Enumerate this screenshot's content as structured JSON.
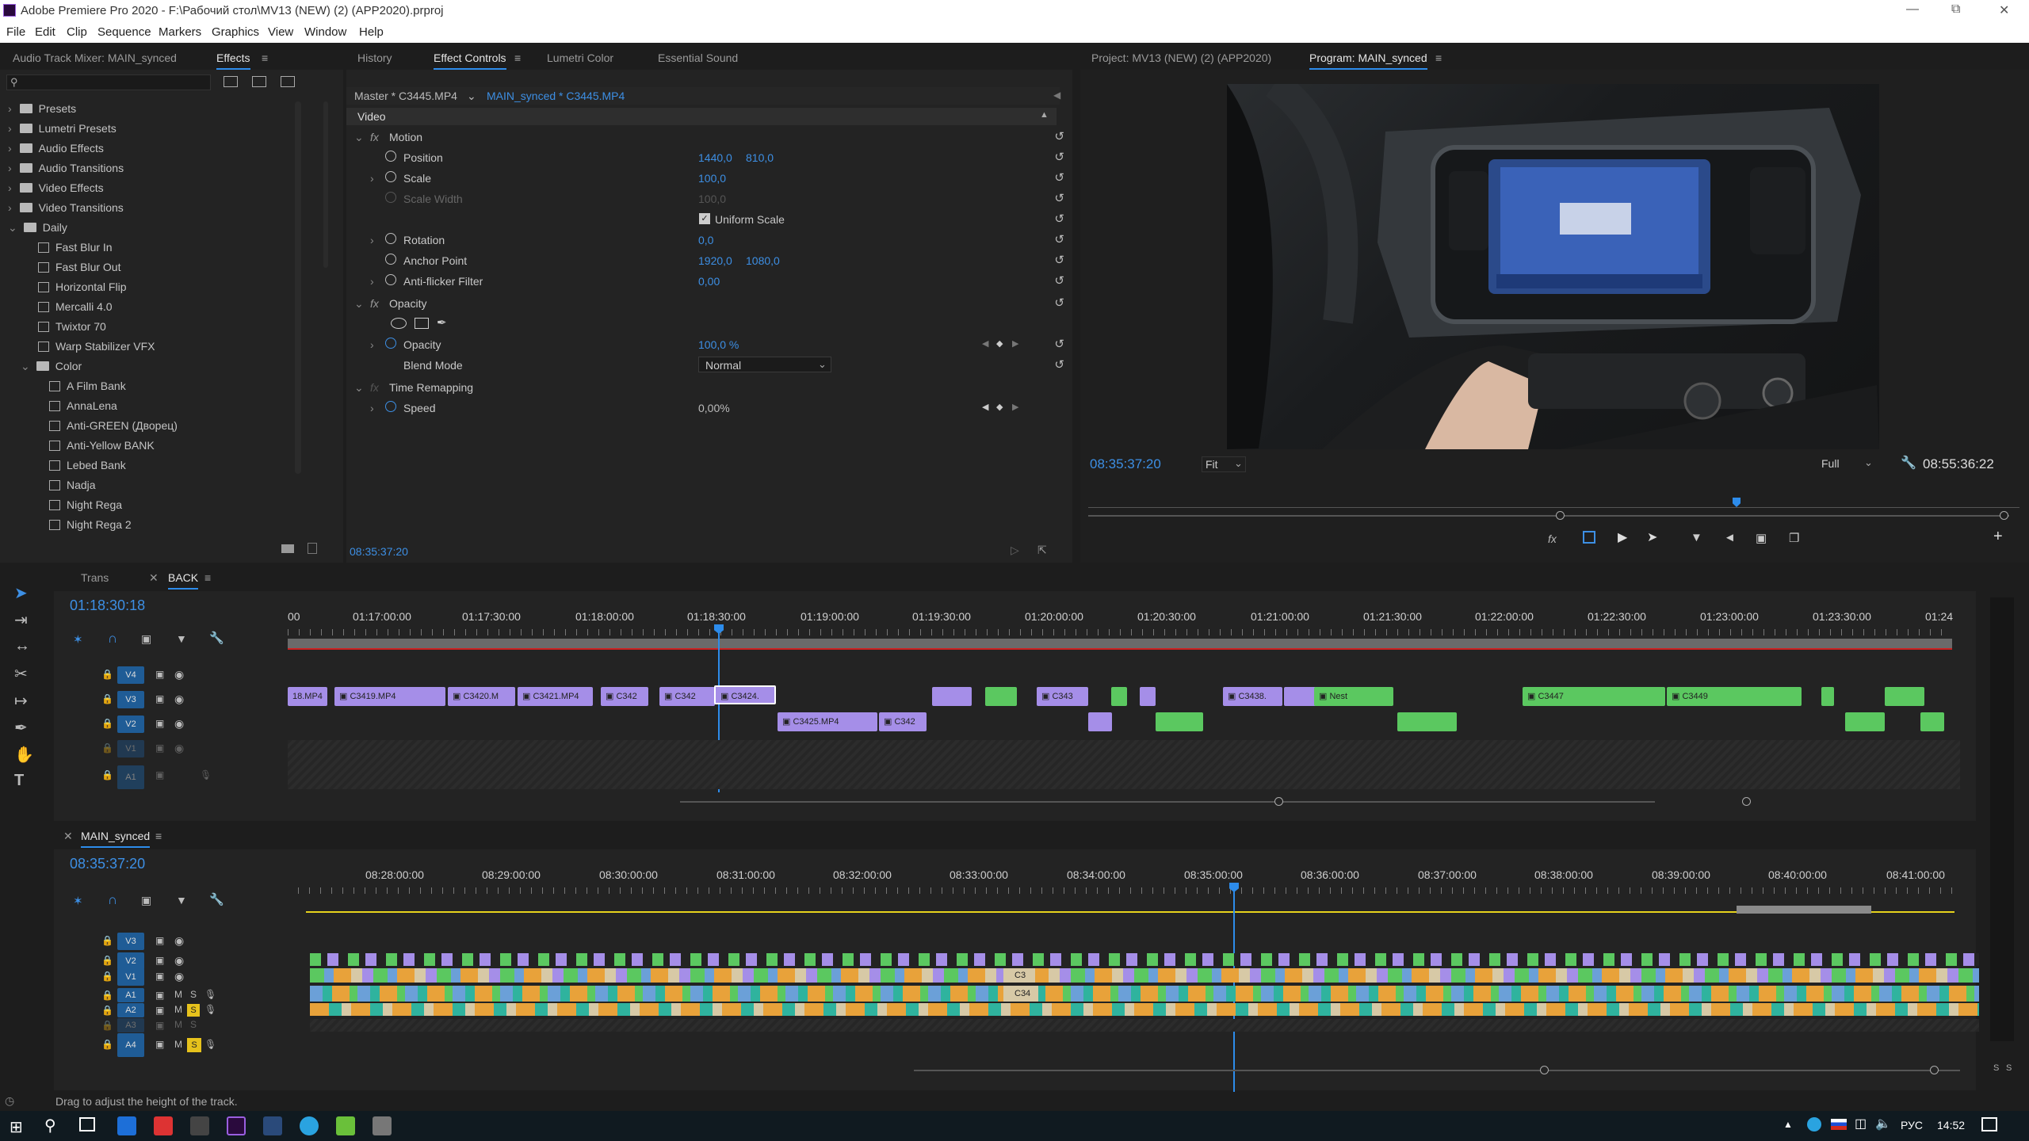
{
  "window": {
    "title": "Adobe Premiere Pro 2020 - F:\\Рабочий стол\\MV13 (NEW) (2) (APP2020).prproj"
  },
  "menu": [
    "File",
    "Edit",
    "Clip",
    "Sequence",
    "Markers",
    "Graphics",
    "View",
    "Window",
    "Help"
  ],
  "effects_panel": {
    "tabs": [
      "Audio Track Mixer: MAIN_synced",
      "Effects"
    ],
    "search_placeholder": "",
    "folders": [
      "Presets",
      "Lumetri Presets",
      "Audio Effects",
      "Audio Transitions",
      "Video Effects",
      "Video Transitions",
      "Daily"
    ],
    "daily_items": [
      "Fast Blur In",
      "Fast Blur Out",
      "Horizontal Flip",
      "Mercalli 4.0",
      "Twixtor 70",
      "Warp Stabilizer VFX"
    ],
    "color_folder": "Color",
    "color_items": [
      "A Film Bank",
      "AnnaLena",
      "Anti-GREEN (Дворец)",
      "Anti-Yellow BANK",
      "Lebed Bank",
      "Nadja",
      "Night Rega",
      "Night Rega 2"
    ]
  },
  "effect_controls": {
    "tabs": [
      "History",
      "Effect Controls",
      "Lumetri Color",
      "Essential Sound"
    ],
    "master": "Master * C3445.MP4",
    "clip": "MAIN_synced * C3445.MP4",
    "section": "Video",
    "motion": "Motion",
    "position_label": "Position",
    "position_x": "1440,0",
    "position_y": "810,0",
    "scale_label": "Scale",
    "scale": "100,0",
    "scale_width_label": "Scale Width",
    "scale_width": "100,0",
    "uniform_scale": "Uniform Scale",
    "rotation_label": "Rotation",
    "rotation": "0,0",
    "anchor_label": "Anchor Point",
    "anchor_x": "1920,0",
    "anchor_y": "1080,0",
    "antiflicker_label": "Anti-flicker Filter",
    "antiflicker": "0,00",
    "opacity_section": "Opacity",
    "opacity_label": "Opacity",
    "opacity": "100,0 %",
    "blend_label": "Blend Mode",
    "blend": "Normal",
    "time_remap": "Time Remapping",
    "speed_label": "Speed",
    "speed": "0,00%",
    "timecode": "08:35:37:20"
  },
  "program": {
    "tabs": [
      "Project: MV13 (NEW) (2) (APP2020)",
      "Program: MAIN_synced"
    ],
    "timecode": "08:35:37:20",
    "fit": "Fit",
    "full": "Full",
    "duration": "08:55:36:22"
  },
  "timeline1": {
    "tabs": [
      "Trans",
      "BACK"
    ],
    "timecode": "01:18:30:18",
    "ruler": [
      "00",
      "01:17:00:00",
      "01:17:30:00",
      "01:18:00:00",
      "01:18:30:00",
      "01:19:00:00",
      "01:19:30:00",
      "01:20:00:00",
      "01:20:30:00",
      "01:21:00:00",
      "01:21:30:00",
      "01:22:00:00",
      "01:22:30:00",
      "01:23:00:00",
      "01:23:30:00",
      "01:24"
    ],
    "tracks": [
      "V4",
      "V3",
      "V2",
      "V1",
      "A1"
    ],
    "clips": [
      "18.MP4",
      "C3419.MP4",
      "C3420.M",
      "C3421.MP4",
      "C342",
      "C342",
      "C3424.",
      "C3425.MP4",
      "C342",
      "C343",
      "C3438.",
      "Nest",
      "C3447",
      "C3449"
    ]
  },
  "timeline2": {
    "tab": "MAIN_synced",
    "timecode": "08:35:37:20",
    "ruler": [
      "08:28:00:00",
      "08:29:00:00",
      "08:30:00:00",
      "08:31:00:00",
      "08:32:00:00",
      "08:33:00:00",
      "08:34:00:00",
      "08:35:00:00",
      "08:36:00:00",
      "08:37:00:00",
      "08:38:00:00",
      "08:39:00:00",
      "08:40:00:00",
      "08:41:00:00"
    ],
    "tracks": [
      "V3",
      "V2",
      "V1",
      "A1",
      "A2",
      "A3",
      "A4"
    ],
    "clips": [
      "C3",
      "C34"
    ]
  },
  "status": {
    "hint": "Drag to adjust the height of the track."
  },
  "audio_meter": {
    "labels": [
      "S",
      "S"
    ]
  },
  "taskbar": {
    "lang": "РУС",
    "time": "14:52"
  }
}
